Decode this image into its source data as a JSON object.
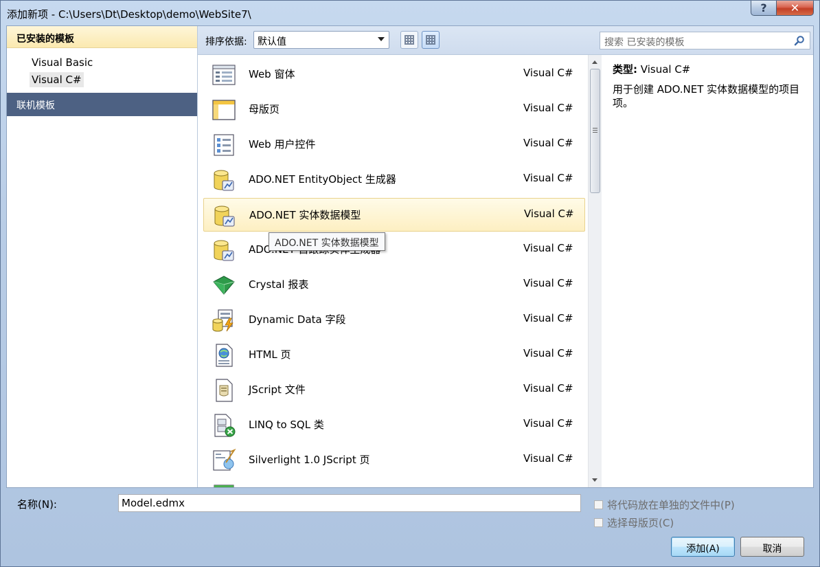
{
  "window": {
    "title": "添加新项 - C:\\Users\\Dt\\Desktop\\demo\\WebSite7\\",
    "help_label": "?",
    "close_label": "✕"
  },
  "sidebar": {
    "installed_header": "已安装的模板",
    "items": [
      {
        "label": "Visual Basic",
        "selected": false
      },
      {
        "label": "Visual C#",
        "selected": true
      }
    ],
    "online_header": "联机模板"
  },
  "toolbar": {
    "sort_label": "排序依据:",
    "sort_value": "默认值",
    "search_placeholder": "搜索 已安装的模板"
  },
  "templates": [
    {
      "name": "Web 窗体",
      "lang": "Visual C#",
      "icon": "web-form-icon"
    },
    {
      "name": "母版页",
      "lang": "Visual C#",
      "icon": "master-page-icon"
    },
    {
      "name": "Web 用户控件",
      "lang": "Visual C#",
      "icon": "user-control-icon"
    },
    {
      "name": "ADO.NET EntityObject 生成器",
      "lang": "Visual C#",
      "icon": "database-icon"
    },
    {
      "name": "ADO.NET 实体数据模型",
      "lang": "Visual C#",
      "icon": "database-icon",
      "selected": true
    },
    {
      "name": "ADO.NET 自跟踪实体生成器",
      "lang": "Visual C#",
      "icon": "database-icon"
    },
    {
      "name": "Crystal 报表",
      "lang": "Visual C#",
      "icon": "crystal-report-icon"
    },
    {
      "name": "Dynamic Data 字段",
      "lang": "Visual C#",
      "icon": "dynamic-data-icon"
    },
    {
      "name": "HTML 页",
      "lang": "Visual C#",
      "icon": "html-page-icon"
    },
    {
      "name": "JScript 文件",
      "lang": "Visual C#",
      "icon": "jscript-file-icon"
    },
    {
      "name": "LINQ to SQL 类",
      "lang": "Visual C#",
      "icon": "linq-to-sql-icon"
    },
    {
      "name": "Silverlight 1.0 JScript 页",
      "lang": "Visual C#",
      "icon": "silverlight-page-icon"
    }
  ],
  "tooltip": "ADO.NET 实体数据模型",
  "details": {
    "type_label": "类型:",
    "type_value": "Visual C#",
    "description": "用于创建 ADO.NET 实体数据模型的项目项。"
  },
  "bottom": {
    "name_label": "名称(N):",
    "name_value": "Model.edmx",
    "check1": "将代码放在单独的文件中(P)",
    "check2": "选择母版页(C)",
    "add_button": "添加(A)",
    "cancel_button": "取消"
  },
  "colors": {
    "selection_bg": "#fdefc2",
    "online_header_bg": "#4d6183",
    "frame": "#aec4e0"
  }
}
